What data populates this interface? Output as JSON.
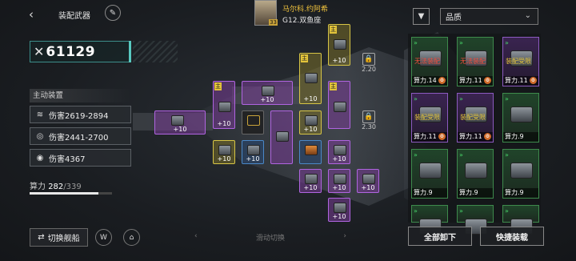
{
  "header": {
    "back_glyph": "‹",
    "title": "装配武器",
    "edit_icon": "feather-icon"
  },
  "power": {
    "value": "61129",
    "icon": "crossed-swords-icon"
  },
  "active_label": "主动装置",
  "stats": [
    {
      "icon": "triple-claw-icon",
      "label": "伤害2619-2894"
    },
    {
      "icon": "spiral-icon",
      "label": "伤害2441-2700"
    },
    {
      "icon": "radar-icon",
      "label": "伤害4367"
    }
  ],
  "compute": {
    "label": "算力",
    "current": "282",
    "max": "/339",
    "fraction": 0.832
  },
  "pilot": {
    "name": "马尔科.约阿希",
    "level": "33",
    "ship": "G12.双鱼座"
  },
  "bottom": {
    "switch_ship": "切换舰船",
    "slide_hint": "滑动切换"
  },
  "slots": {
    "plus_label": "+10",
    "main_tag": "主",
    "locks": [
      "2.20",
      "2.30"
    ]
  },
  "filter": {
    "icon": "filter-icon",
    "quality_label": "品质"
  },
  "inventory": {
    "unequippable": "无法装配",
    "need_assembly": "装配受限",
    "power_prefix": "算力",
    "cards": [
      {
        "warn": "无法装配",
        "power": "算力.14",
        "style": "gr"
      },
      {
        "warn": "无法装配",
        "power": "算力.11",
        "style": "gr"
      },
      {
        "warn": "装配受限",
        "power": "算力.11",
        "style": "pu"
      },
      {
        "warn": "装配受限",
        "power": "算力.11",
        "style": "pu"
      },
      {
        "warn": "装配受限",
        "power": "算力.11",
        "style": "pu"
      },
      {
        "warn": "",
        "power": "算力.9",
        "style": "gr"
      },
      {
        "warn": "",
        "power": "算力.9",
        "style": "gr"
      },
      {
        "warn": "",
        "power": "算力.9",
        "style": "gr"
      },
      {
        "warn": "",
        "power": "算力.9",
        "style": "gr"
      },
      {
        "warn": "",
        "power": "",
        "style": "gr"
      },
      {
        "warn": "",
        "power": "",
        "style": "gr"
      },
      {
        "warn": "",
        "power": "",
        "style": "gr"
      }
    ]
  },
  "actions": {
    "unequip_all": "全部卸下",
    "quick_equip": "快捷装载"
  },
  "colors": {
    "accent": "#58c9c0",
    "purple": "#b064e0",
    "gold": "#e3c43a",
    "warn_red": "#f04b3c"
  }
}
